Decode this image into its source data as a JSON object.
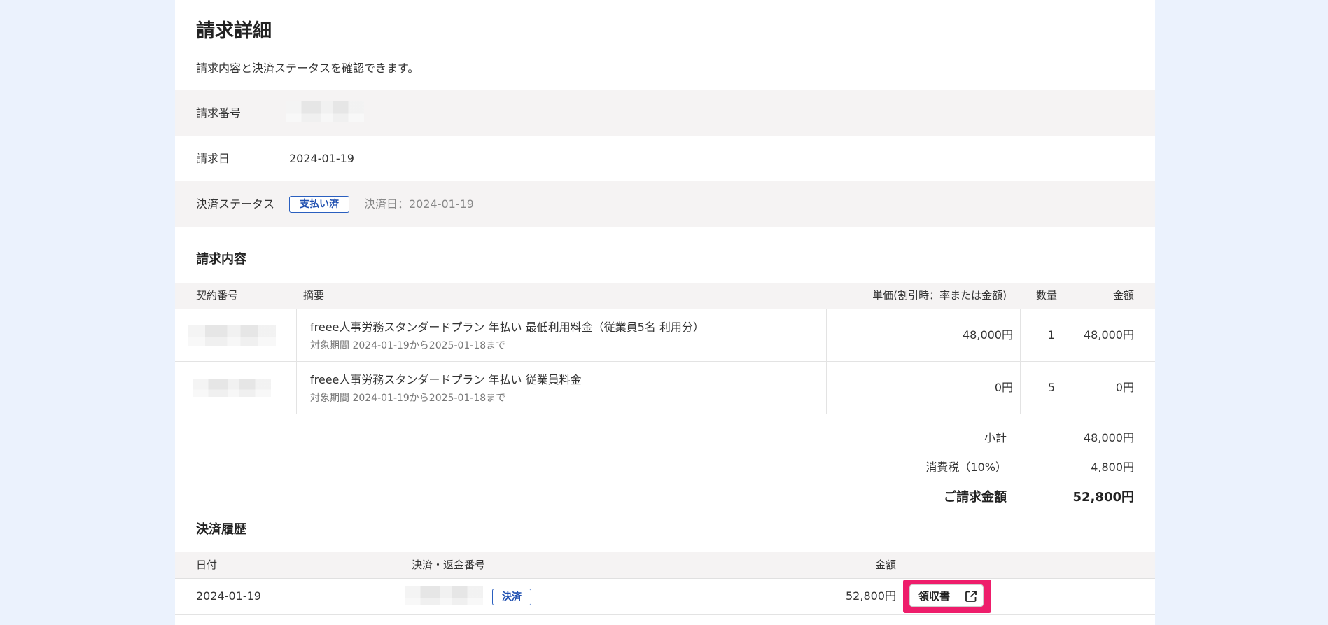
{
  "page": {
    "title": "請求詳細",
    "description": "請求内容と決済ステータスを確認できます。"
  },
  "info": {
    "invoice_number_label": "請求番号",
    "invoice_date_label": "請求日",
    "invoice_date": "2024-01-19",
    "status_label": "決済ステータス",
    "status_badge": "支払い済",
    "payment_date": "決済日：2024-01-19"
  },
  "items_section": {
    "title": "請求内容",
    "headers": {
      "contract_no": "契約番号",
      "summary": "摘要",
      "unit_price": "単価(割引時：率または金額)",
      "qty": "数量",
      "amount": "金額"
    },
    "rows": [
      {
        "summary": "freee人事労務スタンダードプラン 年払い 最低利用料金（従業員5名 利用分）",
        "period": "対象期間 2024-01-19から2025-01-18まで",
        "unit_price": "48,000円",
        "qty": "1",
        "amount": "48,000円"
      },
      {
        "summary": "freee人事労務スタンダードプラン 年払い 従業員料金",
        "period": "対象期間 2024-01-19から2025-01-18まで",
        "unit_price": "0円",
        "qty": "5",
        "amount": "0円"
      }
    ]
  },
  "totals": {
    "subtotal_label": "小計",
    "subtotal": "48,000円",
    "tax_label": "消費税（10%）",
    "tax": "4,800円",
    "total_label": "ご請求金額",
    "total": "52,800円"
  },
  "history": {
    "title": "決済履歴",
    "headers": {
      "date": "日付",
      "number": "決済・返金番号",
      "amount": "金額"
    },
    "rows": [
      {
        "date": "2024-01-19",
        "kind": "決済",
        "amount": "52,800円",
        "receipt_label": "領収書"
      }
    ]
  },
  "colors": {
    "background": "#ebf2fd",
    "badge_blue": "#1f4fb0",
    "highlight": "#ee1d6b"
  },
  "icons": {
    "receipt_icon": "external-link-icon"
  }
}
